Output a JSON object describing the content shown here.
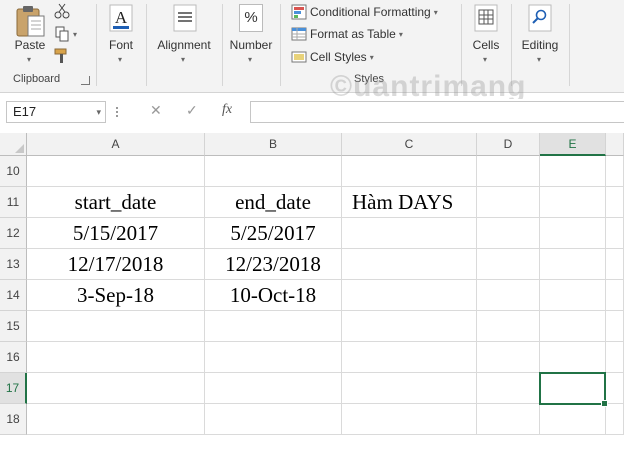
{
  "ribbon": {
    "clipboard": {
      "paste": "Paste",
      "group": "Clipboard"
    },
    "font": {
      "label": "Font"
    },
    "alignment": {
      "label": "Alignment"
    },
    "number": {
      "label": "Number",
      "symbol": "%"
    },
    "styles": {
      "conditional": "Conditional Formatting",
      "table": "Format as Table",
      "cell_styles": "Cell Styles",
      "group": "Styles"
    },
    "cells": {
      "label": "Cells"
    },
    "editing": {
      "label": "Editing"
    }
  },
  "formula_bar": {
    "name_box": "E17",
    "fx": "fx",
    "cancel": "✕",
    "enter": "✓",
    "formula": ""
  },
  "watermark": "©uantrimang",
  "columns": [
    "A",
    "B",
    "C",
    "D",
    "E"
  ],
  "selected_column": "E",
  "rows": [
    {
      "num": "10",
      "cells": [
        "",
        "",
        "",
        "",
        ""
      ]
    },
    {
      "num": "11",
      "cells": [
        "start_date",
        "end_date",
        "Hàm DAYS",
        "",
        ""
      ]
    },
    {
      "num": "12",
      "cells": [
        "5/15/2017",
        "5/25/2017",
        "",
        "",
        ""
      ]
    },
    {
      "num": "13",
      "cells": [
        "12/17/2018",
        "12/23/2018",
        "",
        "",
        ""
      ]
    },
    {
      "num": "14",
      "cells": [
        "3-Sep-18",
        "10-Oct-18",
        "",
        "",
        ""
      ]
    },
    {
      "num": "15",
      "cells": [
        "",
        "",
        "",
        "",
        ""
      ]
    },
    {
      "num": "16",
      "cells": [
        "",
        "",
        "",
        "",
        ""
      ]
    },
    {
      "num": "17",
      "cells": [
        "",
        "",
        "",
        "",
        ""
      ]
    },
    {
      "num": "18",
      "cells": [
        "",
        "",
        "",
        "",
        ""
      ]
    }
  ],
  "selected_row": "17",
  "colors": {
    "accent": "#217346",
    "ribbon_bg": "#f3f3f3"
  }
}
